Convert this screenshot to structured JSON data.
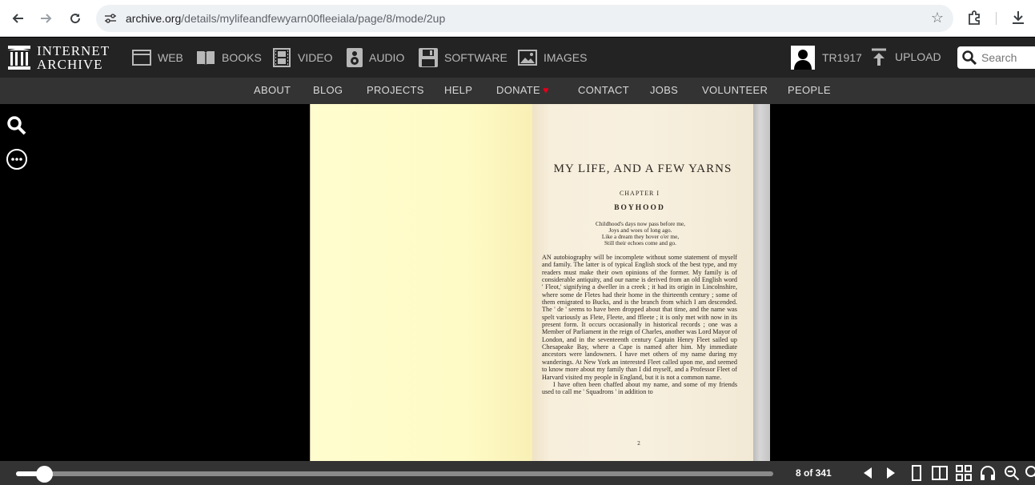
{
  "browser": {
    "url_host": "archive.org",
    "url_path": "/details/mylifeandfewyarn00fleeiala/page/8/mode/2up",
    "icons": [
      "back-icon",
      "forward-icon",
      "reload-icon",
      "site-settings-icon",
      "bookmark-star-icon",
      "extensions-icon",
      "download-icon"
    ]
  },
  "header": {
    "logo_line1": "INTERNET",
    "logo_line2": "ARCHIVE",
    "media_types": [
      {
        "label": "WEB",
        "icon": "web-icon"
      },
      {
        "label": "BOOKS",
        "icon": "book-icon"
      },
      {
        "label": "VIDEO",
        "icon": "film-icon"
      },
      {
        "label": "AUDIO",
        "icon": "speaker-icon"
      },
      {
        "label": "SOFTWARE",
        "icon": "floppy-icon"
      },
      {
        "label": "IMAGES",
        "icon": "image-icon"
      }
    ],
    "username": "TR1917",
    "upload_label": "UPLOAD",
    "search_placeholder": "Search"
  },
  "subnav": {
    "items": [
      "ABOUT",
      "BLOG",
      "PROJECTS",
      "HELP",
      "DONATE",
      "CONTACT",
      "JOBS",
      "VOLUNTEER",
      "PEOPLE"
    ]
  },
  "page": {
    "title": "MY LIFE, AND A FEW YARNS",
    "chapter": "CHAPTER I",
    "subtitle": "BOYHOOD",
    "poem": [
      "Childhood's days now pass before me,",
      "Joys and woes of long ago.",
      "Like a dream they hover o'er me,",
      "Still their echoes come and go."
    ],
    "para1": "AN autobiography will be incomplete without some statement of myself and family. The latter is of typical English stock of the best type, and my readers must make their own opinions of the former. My family is of considerable antiquity, and our name is derived from an old English word ' Fleot,' signifying a dweller in a creek ; it had its origin in Lincolnshire, where some de Fletes had their home in the thirteenth century ; some of them emigrated to Bucks, and is the branch from which I am descended. The ' de ' seems to have been dropped about that time, and the name was spelt variously as Flete, Fleete, and ffleete ; it is only met with now in its present form. It occurs occasionally in historical records ; one was a Member of Parliament in the reign of Charles, another was Lord Mayor of London, and in the seventeenth century Captain Henry Fleet sailed up Chesapeake Bay, where a Cape is named after him. My immediate ancestors were landowners. I have met others of my name during my wanderings. At New York an interested Fleet called upon me, and seemed to know more about my family than I did myself, and a Professor Fleet of Harvard visited my people in England, but it is not a common name.",
    "para2": "I have often been chaffed about my name, and some of my friends used to call me ' Squadrons ' in addition to",
    "signature": "2"
  },
  "reader": {
    "page_indicator": "8 of 341",
    "progress_fraction": 0.037
  }
}
